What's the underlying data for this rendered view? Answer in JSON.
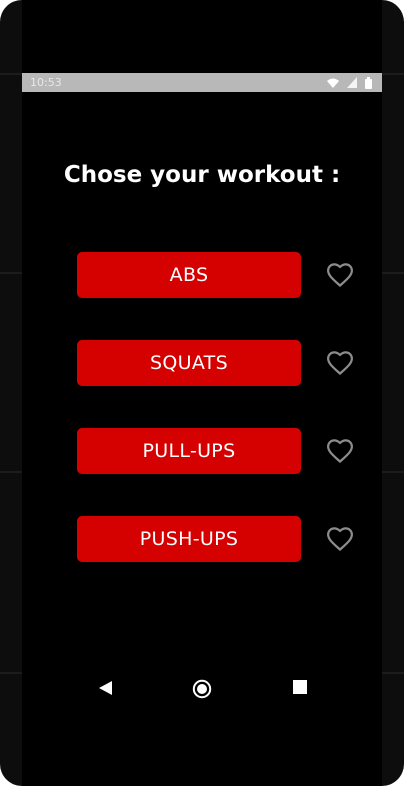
{
  "status_bar": {
    "time": "10:53",
    "icons": [
      "wifi-icon",
      "signal-icon",
      "battery-icon"
    ]
  },
  "title": "Chose your workout :",
  "workouts": [
    {
      "label": "ABS",
      "favorite_icon": "heart-outline-icon"
    },
    {
      "label": "SQUATS",
      "favorite_icon": "heart-outline-icon"
    },
    {
      "label": "PULL-UPS",
      "favorite_icon": "heart-outline-icon"
    },
    {
      "label": "PUSH-UPS",
      "favorite_icon": "heart-outline-icon"
    }
  ],
  "navigation": {
    "icons": [
      "back-icon",
      "home-icon",
      "recents-icon"
    ]
  },
  "colors": {
    "background": "#000000",
    "button": "#d50000",
    "heart": "#8c8c8c",
    "status_bar": "#b8b8b8"
  }
}
